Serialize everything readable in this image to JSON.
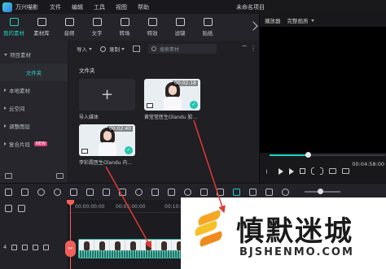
{
  "app": {
    "name": "万兴喵影",
    "document_title": "未命名项目"
  },
  "menu": [
    "文件",
    "编辑",
    "工具",
    "视图",
    "帮助"
  ],
  "toolbar_tabs": [
    {
      "label": "我的素材",
      "icon": "folder-icon",
      "active": true
    },
    {
      "label": "素材库",
      "icon": "library-icon",
      "active": false
    },
    {
      "label": "音频",
      "icon": "music-icon",
      "active": false
    },
    {
      "label": "文字",
      "icon": "text-icon",
      "active": false
    },
    {
      "label": "转场",
      "icon": "transition-icon",
      "active": false
    },
    {
      "label": "特效",
      "icon": "effects-icon",
      "active": false
    },
    {
      "label": "滤镜",
      "icon": "filter-icon",
      "active": false
    },
    {
      "label": "贴纸",
      "icon": "sticker-icon",
      "active": false
    }
  ],
  "sidebar": {
    "items": [
      {
        "label": "项目素材",
        "expanded": true
      },
      {
        "label": "文件夹",
        "sub": true
      },
      {
        "label": "本地素材",
        "expanded": false
      },
      {
        "label": "云空间",
        "expanded": false
      },
      {
        "label": "调整图层",
        "expanded": false
      },
      {
        "label": "复合片段",
        "expanded": false,
        "badge": "NEW"
      }
    ]
  },
  "media_panel": {
    "import_label": "导入",
    "record_label": "录制",
    "search_placeholder": "搜索素材",
    "folder_title": "文件夹",
    "tiles": [
      {
        "label": "导入媒体",
        "type": "import"
      },
      {
        "label": "黄莹莹医生Olandu 胶...",
        "duration": "00:02:18",
        "type": "video",
        "added": true
      },
      {
        "label": "李彩霞医生Olandu 内...",
        "duration": "00:02:40",
        "type": "video",
        "added": true
      }
    ]
  },
  "player": {
    "tab_label": "播放器",
    "quality_label": "完整画质",
    "progress_fraction": 0.33,
    "time": "00:04:58:00"
  },
  "timeline": {
    "ruler_labels": [
      "00:00:00:00",
      "00:05:00:00",
      "00:10:00:00"
    ],
    "track_number": "4",
    "split_label": "✂"
  },
  "watermark": {
    "title": "慎默迷城",
    "subtitle": "BJSHENMO.COM"
  },
  "colors": {
    "accent": "#22d1c0",
    "playhead": "#f0605a",
    "annotation": "#e03a33"
  }
}
